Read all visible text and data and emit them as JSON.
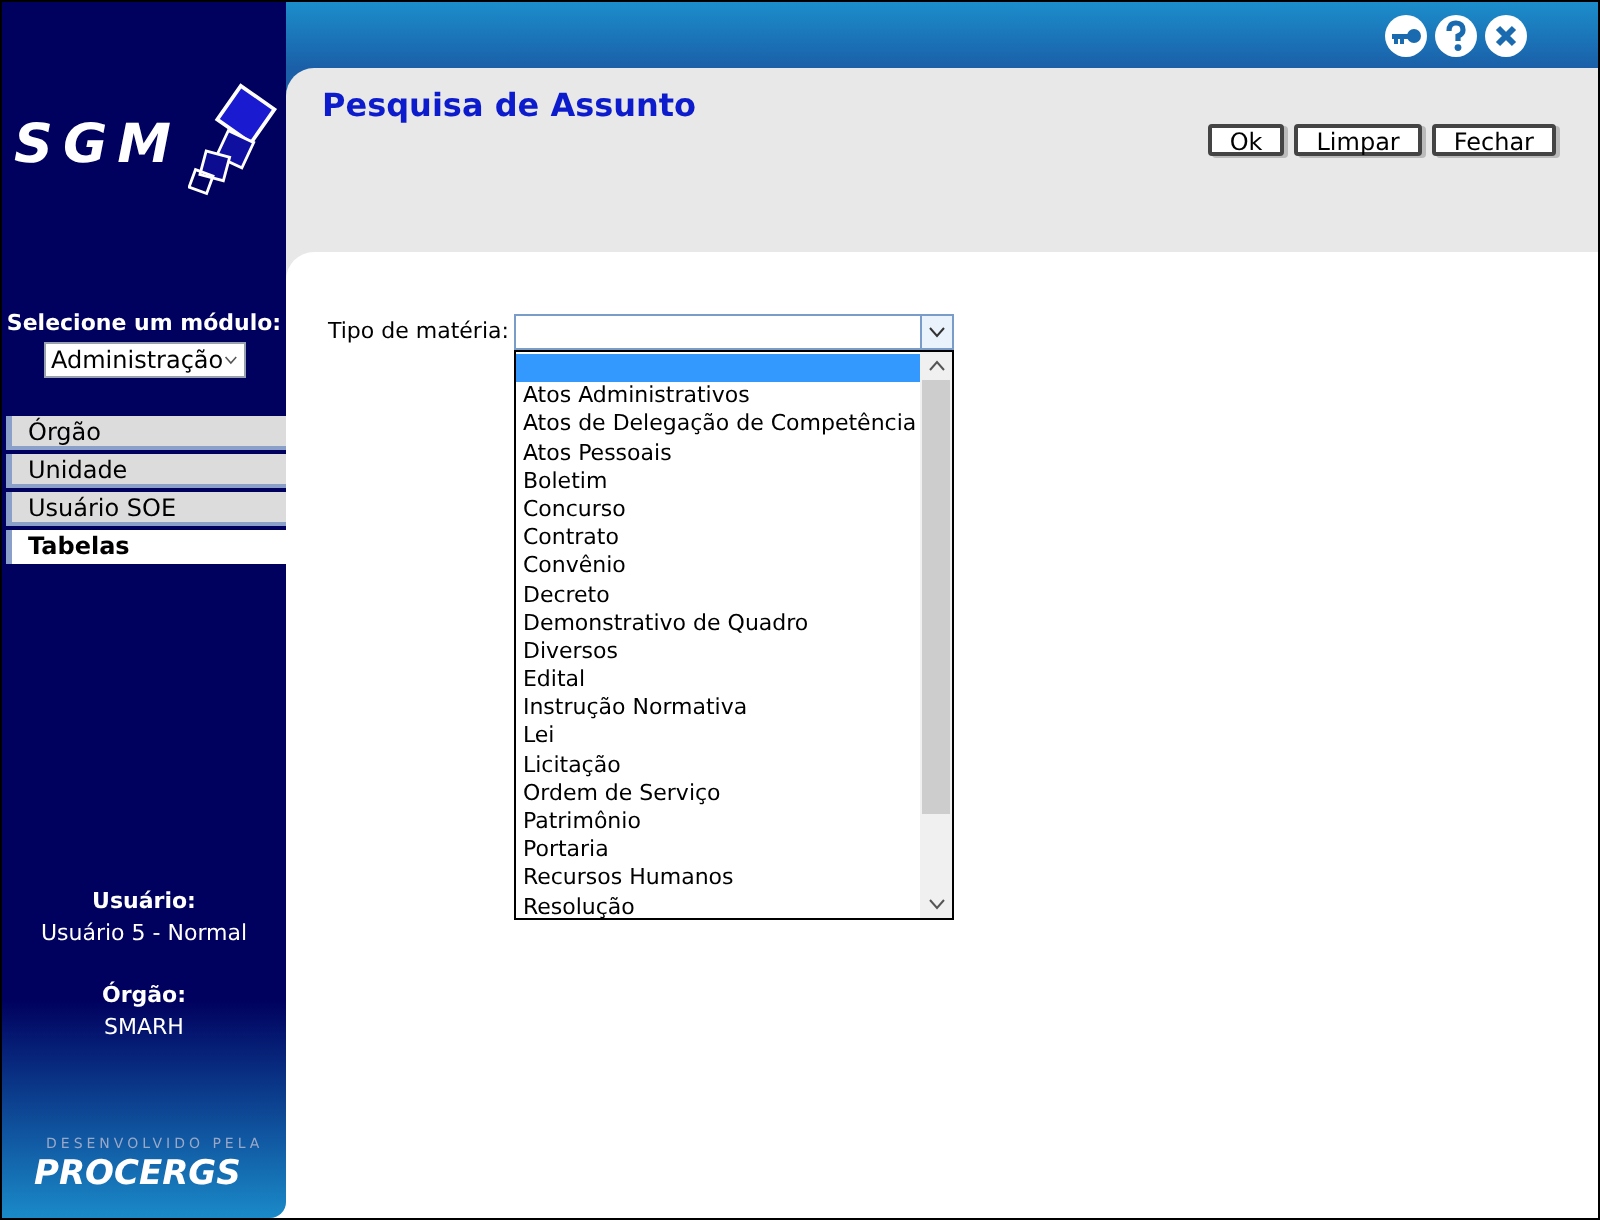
{
  "logo": {
    "text": "SGM"
  },
  "module": {
    "label": "Selecione um módulo:",
    "value": "Administração"
  },
  "nav": [
    {
      "label": "Órgão",
      "selected": false
    },
    {
      "label": "Unidade",
      "selected": false
    },
    {
      "label": "Usuário SOE",
      "selected": false
    },
    {
      "label": "Tabelas",
      "selected": true
    }
  ],
  "user": {
    "label": "Usuário:",
    "value": "Usuário 5 - Normal"
  },
  "org": {
    "label": "Órgão:",
    "value": "SMARH"
  },
  "credit": {
    "caption": "DESENVOLVIDO PELA",
    "brand": "PROCERGS"
  },
  "page_title": "Pesquisa de Assunto",
  "buttons": [
    "Ok",
    "Limpar",
    "Fechar"
  ],
  "field": {
    "label": "Tipo de matéria:",
    "options": [
      {
        "selected": true
      },
      {
        "label": "Atos Administrativos",
        "selected": false
      },
      {
        "label": "Atos de Delegação de Competência",
        "selected": false
      },
      {
        "label": "Atos Pessoais",
        "selected": false
      },
      {
        "label": "Boletim",
        "selected": false
      },
      {
        "label": "Concurso",
        "selected": false
      },
      {
        "label": "Contrato",
        "selected": false
      },
      {
        "label": "Convênio",
        "selected": false
      },
      {
        "label": "Decreto",
        "selected": false
      },
      {
        "label": "Demonstrativo de Quadro",
        "selected": false
      },
      {
        "label": "Diversos",
        "selected": false
      },
      {
        "label": "Edital",
        "selected": false
      },
      {
        "label": "Instrução Normativa",
        "selected": false
      },
      {
        "label": "Lei",
        "selected": false
      },
      {
        "label": "Licitação",
        "selected": false
      },
      {
        "label": "Ordem de Serviço",
        "selected": false
      },
      {
        "label": "Patrimônio",
        "selected": false
      },
      {
        "label": "Portaria",
        "selected": false
      },
      {
        "label": "Recursos Humanos",
        "selected": false
      },
      {
        "label": "Resolução",
        "selected": false
      }
    ]
  }
}
